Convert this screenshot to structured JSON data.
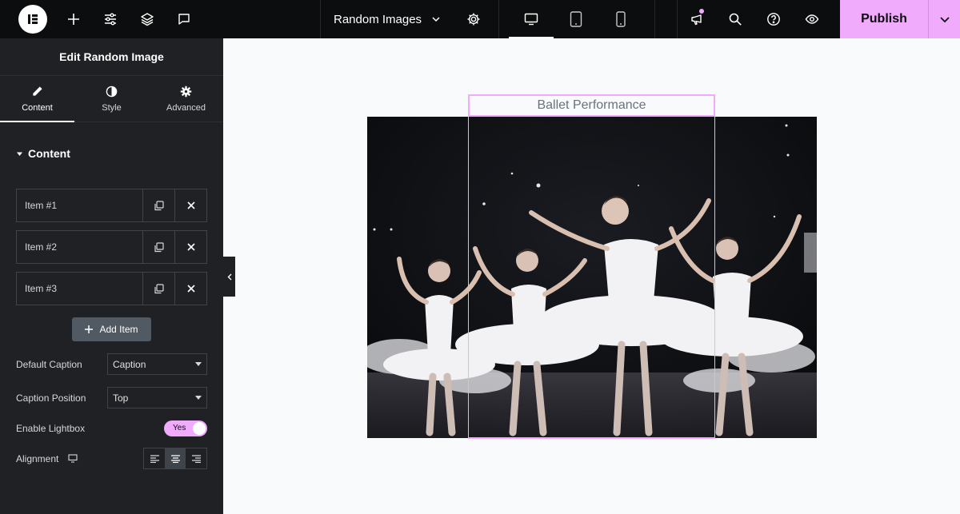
{
  "topbar": {
    "doc_title": "Random Images",
    "publish_label": "Publish",
    "left_icons": [
      "elementor-logo-icon",
      "plus-icon",
      "sliders-icon",
      "layers-icon",
      "comment-icon"
    ],
    "devices": [
      "desktop-icon",
      "tablet-icon",
      "mobile-icon"
    ],
    "right_icons": [
      "announcement-icon",
      "search-icon",
      "help-icon",
      "eye-icon"
    ]
  },
  "panel": {
    "title": "Edit Random Image",
    "tabs": [
      {
        "label": "Content",
        "icon": "pencil-icon",
        "active": true
      },
      {
        "label": "Style",
        "icon": "half-circle-icon",
        "active": false
      },
      {
        "label": "Advanced",
        "icon": "gear-icon",
        "active": false
      }
    ],
    "section_title": "Content",
    "items": [
      {
        "label": "Item #1"
      },
      {
        "label": "Item #2"
      },
      {
        "label": "Item #3"
      }
    ],
    "add_item_label": "Add Item",
    "controls": {
      "default_caption_label": "Default Caption",
      "default_caption_value": "Caption",
      "caption_position_label": "Caption Position",
      "caption_position_value": "Top",
      "lightbox_label": "Enable Lightbox",
      "lightbox_value": "Yes",
      "alignment_label": "Alignment"
    }
  },
  "canvas": {
    "caption": "Ballet Performance"
  },
  "colors": {
    "accent": "#f0abfc",
    "topbar": "#0c0d0e",
    "panel": "#1f2124",
    "canvas": "#f9fafb"
  }
}
